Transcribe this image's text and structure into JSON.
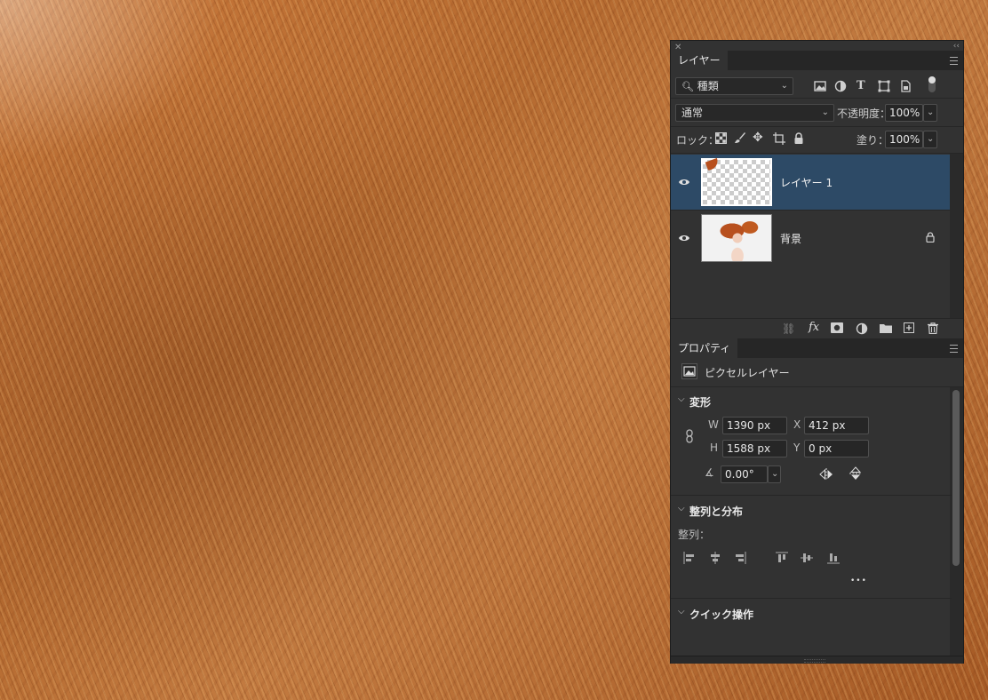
{
  "layers_panel": {
    "tab_label": "レイヤー",
    "filter_kind": "種類",
    "blend_mode": "通常",
    "opacity_label": "不透明度：",
    "opacity_value": "100%",
    "lock_label": "ロック：",
    "fill_label": "塗り：",
    "fill_value": "100%",
    "layers": [
      {
        "name": "レイヤー 1",
        "selected": true,
        "visible": true,
        "locked": false
      },
      {
        "name": "背景",
        "selected": false,
        "visible": true,
        "locked": true
      }
    ],
    "footer_icons": [
      "link-icon",
      "fx-icon",
      "mask-icon",
      "adjustment-icon",
      "folder-icon",
      "new-layer-icon",
      "trash-icon"
    ]
  },
  "properties_panel": {
    "tab_label": "プロパティ",
    "layer_type": "ピクセルレイヤー",
    "transform": {
      "title": "変形",
      "w_label": "W",
      "w_value": "1390 px",
      "h_label": "H",
      "h_value": "1588 px",
      "x_label": "X",
      "x_value": "412 px",
      "y_label": "Y",
      "y_value": "0 px",
      "angle_value": "0.00°"
    },
    "align": {
      "title": "整列と分布",
      "label": "整列：",
      "more": "•••"
    },
    "quick_actions": {
      "title": "クイック操作"
    }
  },
  "colors": {
    "panel_bg": "#323232",
    "selected_row": "#2d4a66",
    "canvas_hair": "#b9692e"
  }
}
